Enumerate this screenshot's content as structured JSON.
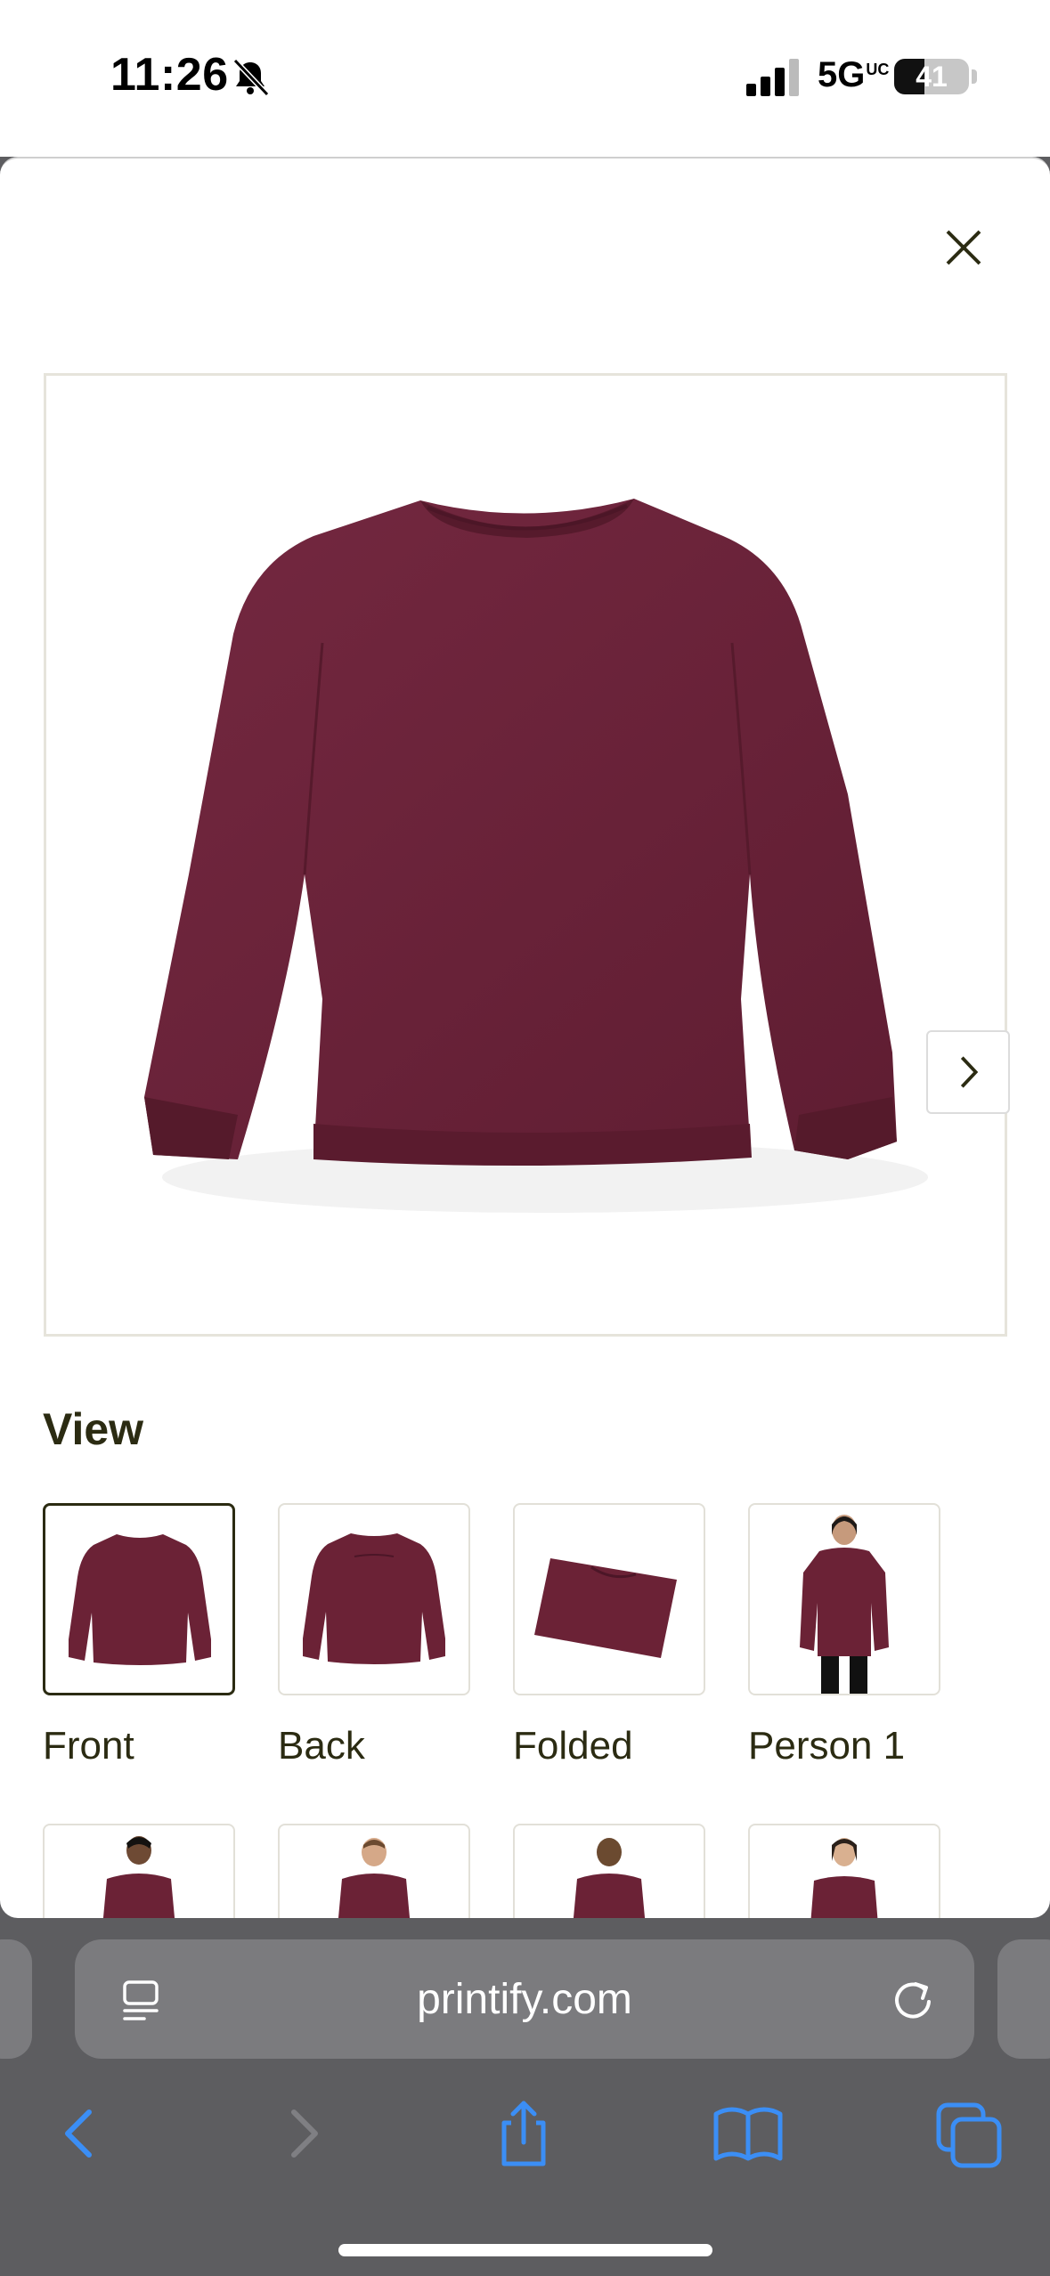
{
  "status_bar": {
    "time": "11:26",
    "network": "5G",
    "network_suffix": "UC",
    "battery": "41",
    "battery_level": 0.41
  },
  "modal": {
    "close_icon": "close-icon",
    "next_icon": "chevron-right-icon",
    "product_color": "#6b2236",
    "view_heading": "View",
    "views": [
      {
        "label": "Front",
        "selected": true
      },
      {
        "label": "Back",
        "selected": false
      },
      {
        "label": "Folded",
        "selected": false
      },
      {
        "label": "Person 1",
        "selected": false
      }
    ]
  },
  "browser": {
    "url": "printify.com",
    "accent": "#3b8ef5"
  }
}
